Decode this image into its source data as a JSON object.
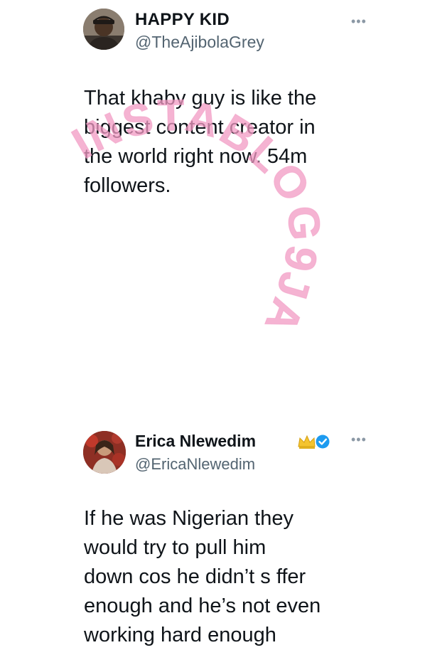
{
  "tweets": [
    {
      "display_name": "HAPPY KID",
      "handle": "@TheAjibolaGrey",
      "more_icon": "more-horizontal-icon",
      "text": "That khaby guy is like the\nbiggest content creator in\nthe world right now. 54m\nfollowers."
    },
    {
      "display_name": "Erica Nlewedim",
      "handle": "@EricaNlewedim",
      "more_icon": "more-horizontal-icon",
      "badges": [
        "crown-emoji-icon",
        "verified-badge-icon"
      ],
      "text": "If he was Nigerian they\nwould try to pull him\ndown cos he didn’t s ffer\nenough and he’s not even\nworking hard enough"
    }
  ],
  "watermark": {
    "text": "INSTABLOG9JA",
    "color": "#f29ac3"
  },
  "colors": {
    "text_primary": "#0f1419",
    "text_secondary": "#536471",
    "verified_blue": "#1d9bf0"
  }
}
